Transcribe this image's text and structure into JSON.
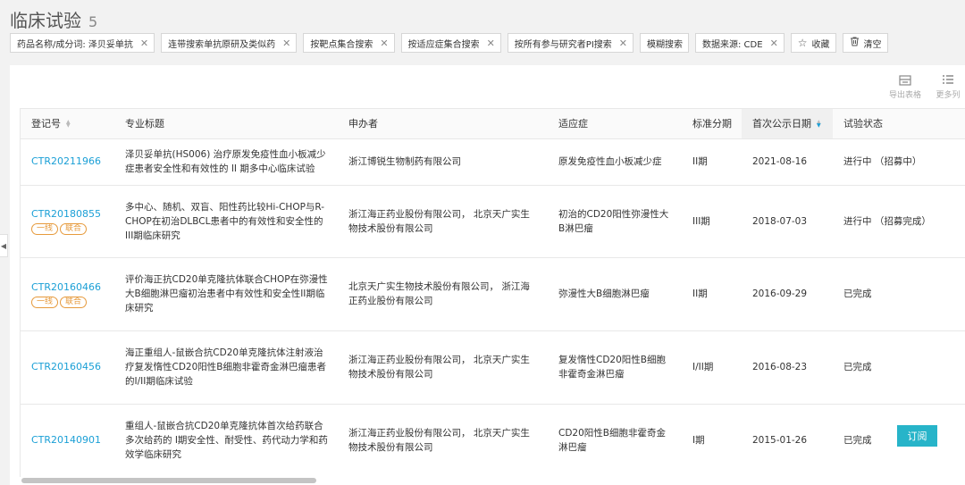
{
  "header": {
    "title": "临床试验",
    "count": "5"
  },
  "filters": [
    {
      "label": "药品名称/成分词: 泽贝妥单抗",
      "closable": true
    },
    {
      "label": "连带搜索单抗原研及类似药",
      "closable": true
    },
    {
      "label": "按靶点集合搜索",
      "closable": true
    },
    {
      "label": "按适应症集合搜索",
      "closable": true
    },
    {
      "label": "按所有参与研究者PI搜索",
      "closable": true
    },
    {
      "label": "模糊搜索",
      "closable": false
    },
    {
      "label": "数据来源: CDE",
      "closable": true
    }
  ],
  "actions": {
    "favorite": "收藏",
    "clear": "清空"
  },
  "tools": {
    "export": "导出表格",
    "more_columns": "更多列"
  },
  "table": {
    "columns": [
      "登记号",
      "专业标题",
      "申办者",
      "适应症",
      "标准分期",
      "首次公示日期",
      "试验状态"
    ],
    "rows": [
      {
        "id": "CTR20211966",
        "title": "泽贝妥单抗(HS006) 治疗原发免疫性血小板减少症患者安全性和有效性的 II 期多中心临床试验",
        "sponsor": "浙江博锐生物制药有限公司",
        "indication": "原发免疫性血小板减少症",
        "phase": "II期",
        "date": "2021-08-16",
        "status": "进行中 （招募中）",
        "tags": []
      },
      {
        "id": "CTR20180855",
        "title": "多中心、随机、双盲、阳性药比较Hi-CHOP与R-CHOP在初治DLBCL患者中的有效性和安全性的III期临床研究",
        "sponsor": "浙江海正药业股份有限公司， 北京天广实生物技术股份有限公司",
        "indication": "初治的CD20阳性弥漫性大B淋巴瘤",
        "phase": "III期",
        "date": "2018-07-03",
        "status": "进行中 （招募完成）",
        "tags": [
          "一线",
          "联合"
        ]
      },
      {
        "id": "CTR20160466",
        "title": "评价海正抗CD20单克隆抗体联合CHOP在弥漫性大B细胞淋巴瘤初治患者中有效性和安全性II期临床研究",
        "sponsor": "北京天广实生物技术股份有限公司， 浙江海正药业股份有限公司",
        "indication": "弥漫性大B细胞淋巴瘤",
        "phase": "II期",
        "date": "2016-09-29",
        "status": "已完成",
        "tags": [
          "一线",
          "联合"
        ]
      },
      {
        "id": "CTR20160456",
        "title": "海正重组人-鼠嵌合抗CD20单克隆抗体注射液治疗复发惰性CD20阳性B细胞非霍奇金淋巴瘤患者的I/II期临床试验",
        "sponsor": "浙江海正药业股份有限公司， 北京天广实生物技术股份有限公司",
        "indication": "复发惰性CD20阳性B细胞非霍奇金淋巴瘤",
        "phase": "I/II期",
        "date": "2016-08-23",
        "status": "已完成",
        "tags": []
      },
      {
        "id": "CTR20140901",
        "title": "重组人-鼠嵌合抗CD20单克隆抗体首次给药联合多次给药的 I期安全性、耐受性、药代动力学和药效学临床研究",
        "sponsor": "浙江海正药业股份有限公司， 北京天广实生物技术股份有限公司",
        "indication": "CD20阳性B细胞非霍奇金淋巴瘤",
        "phase": "I期",
        "date": "2015-01-26",
        "status": "已完成",
        "tags": []
      }
    ],
    "subscribe_label": "订阅"
  },
  "colors": {
    "link": "#1a9fd6",
    "accent_button": "#27b4c9",
    "tag": "#e69a3c"
  },
  "icons": {
    "close": "close-icon",
    "star": "star-icon",
    "trash": "trash-icon",
    "export": "export-table-icon",
    "columns": "column-list-icon",
    "collapse": "chevron-left-icon"
  }
}
